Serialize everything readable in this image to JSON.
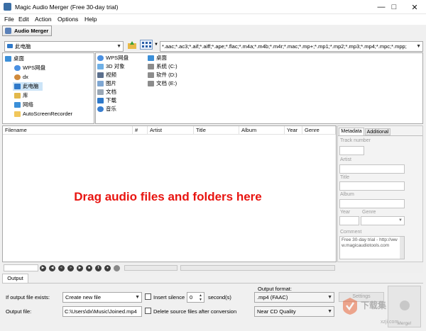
{
  "window": {
    "title": "Magic Audio Merger (Free 30-day trial)"
  },
  "menu": [
    "File",
    "Edit",
    "Action",
    "Options",
    "Help"
  ],
  "toolbar": {
    "tab_label": "Audio Merger"
  },
  "filebar": {
    "location": "此电脑",
    "filter": "*.aac;*.ac3;*.aif;*.aiff;*.ape;*.flac;*.m4a;*.m4b;*.m4r;*.mac;*.mp+;*.mp1;*.mp2;*.mp3;*.mp4;*.mpc;*.mpp;"
  },
  "tree": [
    "桌面",
    "WPS网盘",
    "dx",
    "此电脑",
    "库",
    "网络",
    "AutoScreenRecorder"
  ],
  "folders": [
    "WPS网盘",
    "3D 对象",
    "视频",
    "图片",
    "文档",
    "下载",
    "音乐"
  ],
  "drives": [
    "桌面",
    "系统 (C:)",
    "软件 (D:)",
    "文档 (E:)"
  ],
  "columns": [
    "Filename",
    "#",
    "Artist",
    "Title",
    "Album",
    "Year",
    "Genre"
  ],
  "drag_message": "Drag audio files and folders here",
  "metadata": {
    "tabs": [
      "Metadata",
      "Additional"
    ],
    "labels": {
      "track": "Track number",
      "artist": "Artist",
      "title": "Title",
      "album": "Album",
      "year": "Year",
      "genre": "Genre",
      "comment": "Comment"
    },
    "comment_text": "Free 30-day trial - http://www.magicaudiotools.com"
  },
  "output": {
    "tab": "Output",
    "exists_label": "If output file exists:",
    "exists_value": "Create new file",
    "silence_label": "Insert silence",
    "silence_value": "0",
    "seconds_label": "second(s)",
    "format_label": "Output format:",
    "format_value": ".mp4 (FAAC)",
    "settings_label": "Settings",
    "merge_label": "Merge!",
    "file_label": "Output file:",
    "file_value": "C:\\Users\\dx\\Music\\Joined.mp4",
    "delete_label": "Delete source files after conversion",
    "quality_value": "Near CD Quality"
  },
  "watermark": {
    "brand": "下载集",
    "url": "xzji.com"
  }
}
